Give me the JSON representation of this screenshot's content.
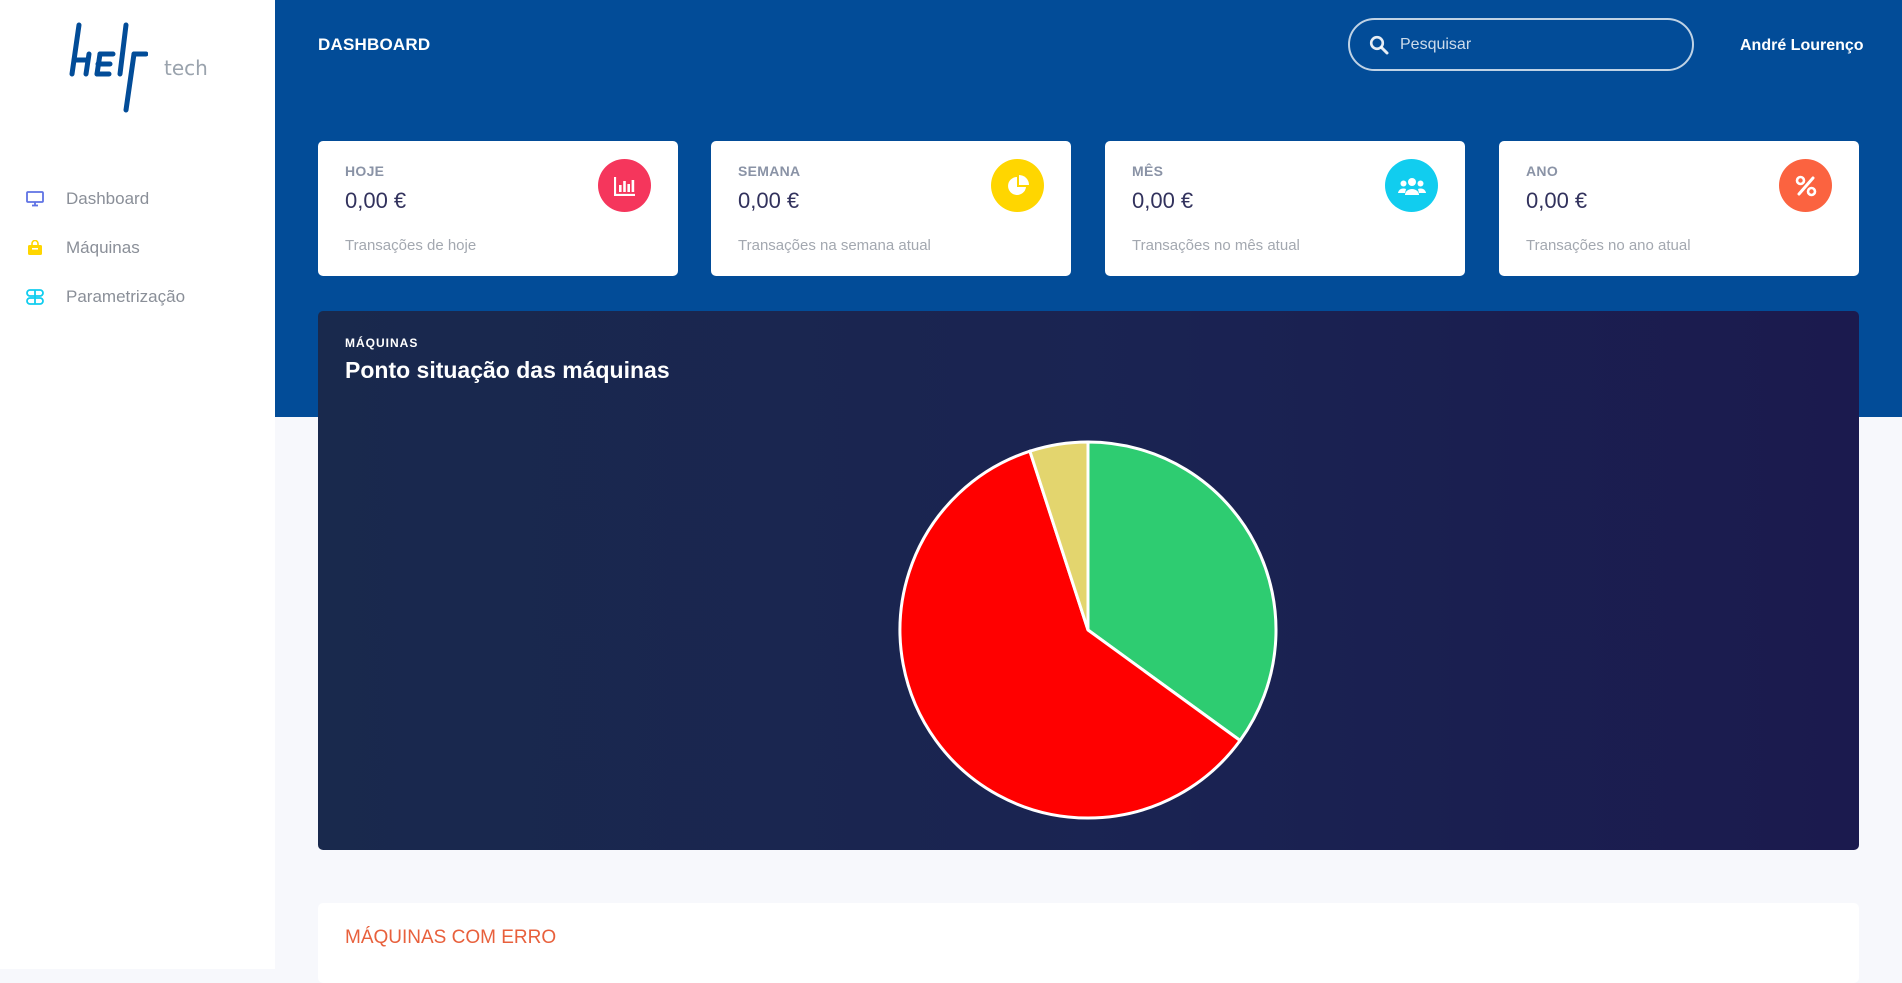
{
  "app": {
    "logo_text": "help",
    "logo_suffix": "tech"
  },
  "sidebar": {
    "items": [
      {
        "label": "Dashboard",
        "icon": "monitor-icon",
        "color": "#5e72e4"
      },
      {
        "label": "Máquinas",
        "icon": "shopping-bag-icon",
        "color": "#ffd600"
      },
      {
        "label": "Parametrização",
        "icon": "settings-grid-icon",
        "color": "#11cdef"
      }
    ]
  },
  "header": {
    "title": "DASHBOARD",
    "search_placeholder": "Pesquisar",
    "user": "André Lourenço"
  },
  "stats": [
    {
      "label": "HOJE",
      "value": "0,00 €",
      "description": "Transações de hoje",
      "icon": "bar-chart-icon",
      "color": "#f5365c"
    },
    {
      "label": "SEMANA",
      "value": "0,00 €",
      "description": "Transações na semana atual",
      "icon": "pie-chart-icon",
      "color": "#ffd600"
    },
    {
      "label": "MÊS",
      "value": "0,00 €",
      "description": "Transações no mês atual",
      "icon": "users-icon",
      "color": "#11cdef"
    },
    {
      "label": "ANO",
      "value": "0,00 €",
      "description": "Transações no ano atual",
      "icon": "percent-icon",
      "color": "#fb6340"
    }
  ],
  "machines_chart": {
    "subtitle": "MÁQUINAS",
    "title": "Ponto situação das máquinas"
  },
  "chart_data": {
    "type": "pie",
    "title": "Ponto situação das máquinas",
    "values": [
      35,
      60,
      5
    ],
    "colors": [
      "#2ecc71",
      "#ff0000",
      "#e3d56e"
    ],
    "start_angle": "top, clockwise"
  },
  "errors_panel": {
    "title": "MÁQUINAS COM ERRO"
  }
}
